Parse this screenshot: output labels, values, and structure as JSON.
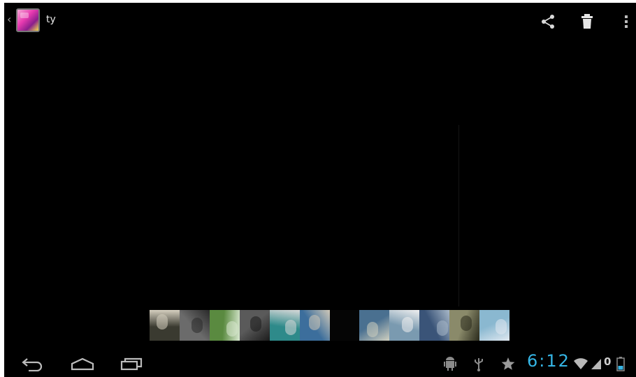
{
  "action_bar": {
    "album_title": "ty",
    "icons": [
      "app-gallery-icon",
      "share-icon",
      "trash-icon",
      "overflow-menu-icon"
    ]
  },
  "filmstrip": {
    "count": 12,
    "thumbnails": [
      {
        "name": "photo-1",
        "bg": "#3a3a30",
        "accent": "#d6d0c0"
      },
      {
        "name": "photo-2",
        "bg": "#6b6b6b",
        "accent": "#2a2a2a"
      },
      {
        "name": "photo-3",
        "bg": "#5a8a40",
        "accent": "#d8e8d0"
      },
      {
        "name": "photo-4",
        "bg": "#5a5a5a",
        "accent": "#1c1c1c"
      },
      {
        "name": "photo-5",
        "bg": "#2e8a8a",
        "accent": "#d8d8d8"
      },
      {
        "name": "photo-6",
        "bg": "#3c6e9c",
        "accent": "#d0c8b8"
      },
      {
        "name": "photo-7",
        "bg": "#050505",
        "accent": "#050505"
      },
      {
        "name": "photo-8",
        "bg": "#4a7090",
        "accent": "#d0d0c0"
      },
      {
        "name": "photo-9",
        "bg": "#7a9ab0",
        "accent": "#f0f0f0"
      },
      {
        "name": "photo-10",
        "bg": "#3a5478",
        "accent": "#a8b8c8"
      },
      {
        "name": "photo-11",
        "bg": "#8a8a6a",
        "accent": "#2a2a1c"
      },
      {
        "name": "photo-12",
        "bg": "#8ab8d0",
        "accent": "#e0e8f0"
      }
    ]
  },
  "system_bar": {
    "clock": "6:12",
    "battery_label": "0",
    "nav_icons": [
      "back-icon",
      "home-icon",
      "recent-apps-icon"
    ],
    "status_icons": [
      "android-debug-icon",
      "usb-icon",
      "star-icon",
      "wifi-icon",
      "signal-icon",
      "battery-icon"
    ]
  },
  "colors": {
    "accent": "#35b5e5",
    "background": "#000000",
    "icon": "#d9d9d9"
  }
}
